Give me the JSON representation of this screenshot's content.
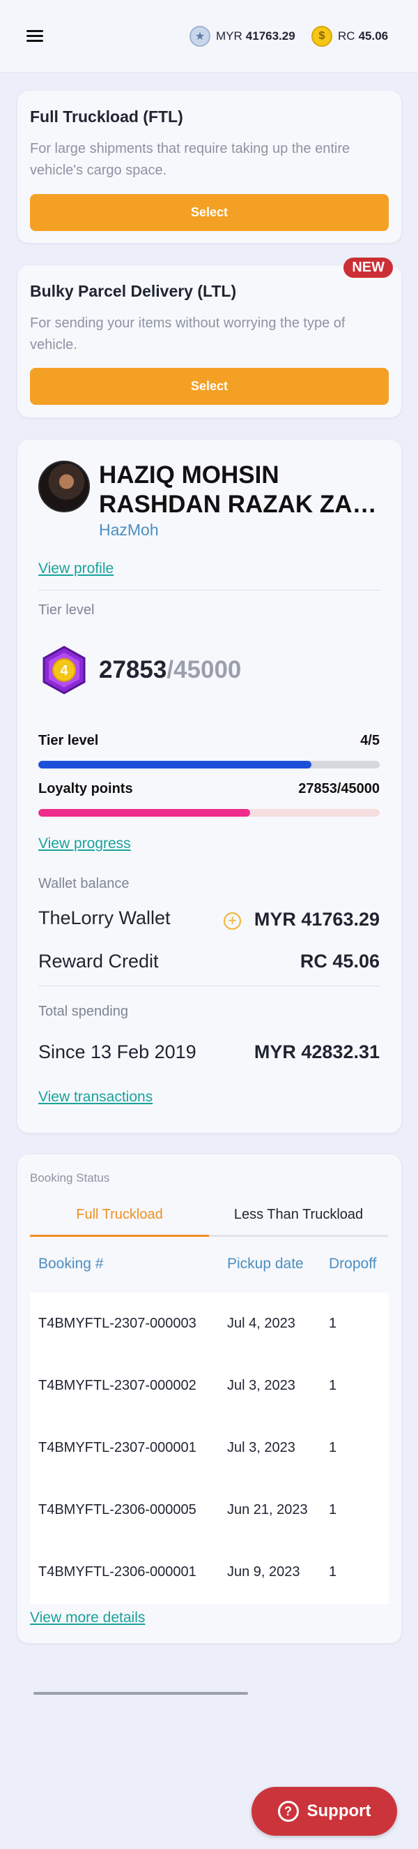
{
  "header": {
    "myr_label": "MYR",
    "myr_value": "41763.29",
    "rc_label": "RC",
    "rc_value": "45.06"
  },
  "services": [
    {
      "title": "Full Truckload (FTL)",
      "description": "For large shipments that require taking up the entire vehicle's cargo space.",
      "button": "Select"
    },
    {
      "title": "Bulky Parcel Delivery (LTL)",
      "description": "For sending your items without worrying the type of vehicle.",
      "button": "Select",
      "badge": "NEW"
    }
  ],
  "profile": {
    "name_line1": "HAZIQ MOHSIN",
    "name_line2": "RASHDAN RAZAK ZAKARIA",
    "nickname": "HazMoh",
    "view_profile": "View profile",
    "tier_label": "Tier level",
    "tier_badge_number": "4",
    "points": "27853",
    "points_of": "/45000",
    "tier_progress_label": "Tier level",
    "tier_progress_value": "4/5",
    "tier_fraction": 0.8,
    "loyalty_label": "Loyalty points",
    "loyalty_value": "27853/45000",
    "loyalty_fraction": 0.62,
    "view_progress": "View progress",
    "wallet_label": "Wallet balance",
    "wallet_name": "TheLorry Wallet",
    "wallet_value": "MYR 41763.29",
    "reward_name": "Reward Credit",
    "reward_value": "RC 45.06",
    "spending_label": "Total spending",
    "spending_since": "Since 13 Feb 2019",
    "spending_value": "MYR 42832.31",
    "view_transactions": "View transactions"
  },
  "booking": {
    "title": "Booking Status",
    "tabs": [
      "Full Truckload",
      "Less Than Truckload"
    ],
    "columns": [
      "Booking #",
      "Pickup date",
      "Dropoff"
    ],
    "rows": [
      [
        "T4BMYFTL-2307-000003",
        "Jul 4, 2023",
        "1"
      ],
      [
        "T4BMYFTL-2307-000002",
        "Jul 3, 2023",
        "1"
      ],
      [
        "T4BMYFTL-2307-000001",
        "Jul 3, 2023",
        "1"
      ],
      [
        "T4BMYFTL-2306-000005",
        "Jun 21, 2023",
        "1"
      ],
      [
        "T4BMYFTL-2306-000001",
        "Jun 9, 2023",
        "1"
      ]
    ],
    "view_more": "View more details"
  },
  "support": {
    "label": "Support",
    "icon_glyph": "?"
  },
  "colors": {
    "accent_orange": "#f4a024",
    "tier_blue": "#1d4fd8",
    "loyalty_pink": "#ee2d8d",
    "link_teal": "#18a39b",
    "support_red": "#cc343b"
  }
}
